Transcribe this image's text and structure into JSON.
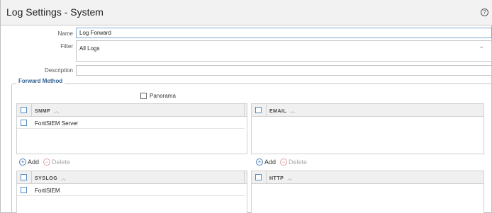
{
  "dialog": {
    "title": "Log Settings - System",
    "help_glyph": "?"
  },
  "form": {
    "name_label": "Name",
    "name_value": "Log Forward",
    "filter_label": "Filter",
    "filter_value": "All Logs",
    "description_label": "Description",
    "description_value": ""
  },
  "forward": {
    "legend": "Forward Method",
    "panorama_label": "Panorama",
    "panorama_checked": false
  },
  "tables": {
    "snmp": {
      "title": "SNMP",
      "rows": [
        "FortiSIEM Server"
      ]
    },
    "email": {
      "title": "EMAIL",
      "rows": []
    },
    "syslog": {
      "title": "SYSLOG",
      "rows": [
        "FortiSIEM"
      ]
    },
    "http": {
      "title": "HTTP",
      "rows": []
    }
  },
  "actions": {
    "add_label": "Add",
    "delete_label": "Delete"
  },
  "colors": {
    "accent": "#2f5f8f",
    "checkbox": "#5a8ec0"
  }
}
